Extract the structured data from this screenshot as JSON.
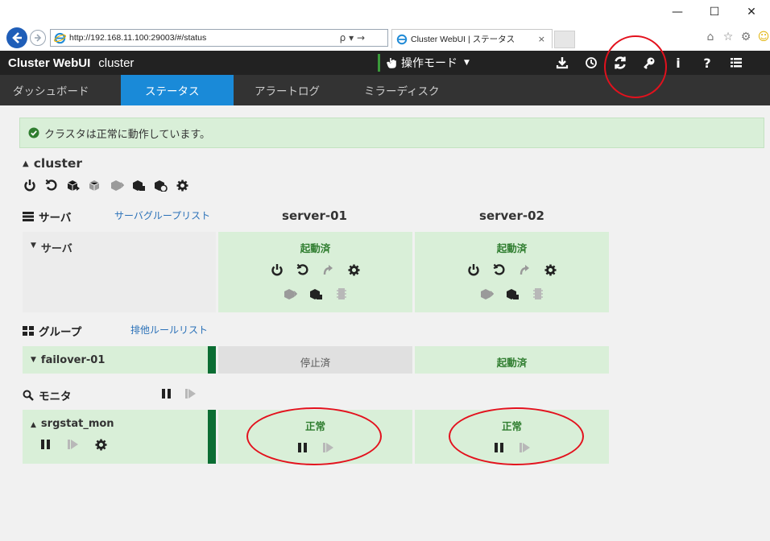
{
  "browser": {
    "window_controls": {
      "minimize": "—",
      "maximize": "☐",
      "close": "✕"
    },
    "url": "http://192.168.11.100:29003/#/status",
    "search_glyph": "ρ ▾ →",
    "tab_title": "Cluster WebUI | ステータス",
    "tab_close": "×"
  },
  "app": {
    "brand": "Cluster WebUI",
    "cluster": "cluster",
    "mode_label": "操作モード",
    "header_icons": [
      "download-icon",
      "history-icon",
      "refresh-icon",
      "key-icon",
      "info-icon",
      "help-icon",
      "log-icon"
    ]
  },
  "tabs": [
    {
      "label": "ダッシュボード",
      "active": false
    },
    {
      "label": "ステータス",
      "active": true
    },
    {
      "label": "アラートログ",
      "active": false
    },
    {
      "label": "ミラーディスク",
      "active": false
    }
  ],
  "alert": {
    "text": "クラスタは正常に動作しています。",
    "color": "#d9efd8"
  },
  "cluster": {
    "name": "cluster"
  },
  "servers_section": {
    "title": "サーバ",
    "link": "サーバグループリスト",
    "row_label": "サーバ",
    "server_names": [
      "server-01",
      "server-02"
    ],
    "statuses": [
      "起動済",
      "起動済"
    ]
  },
  "groups_section": {
    "title": "グループ",
    "link": "排他ルールリスト",
    "group_name": "failover-01",
    "statuses": [
      "停止済",
      "起動済"
    ]
  },
  "monitors_section": {
    "title": "モニタ",
    "monitor_name": "srgstat_mon",
    "statuses": [
      "正常",
      "正常"
    ]
  },
  "colors": {
    "accent": "#1a8ad8",
    "ok_green": "#2f7d2f",
    "highlight_ring": "#e3111d"
  }
}
